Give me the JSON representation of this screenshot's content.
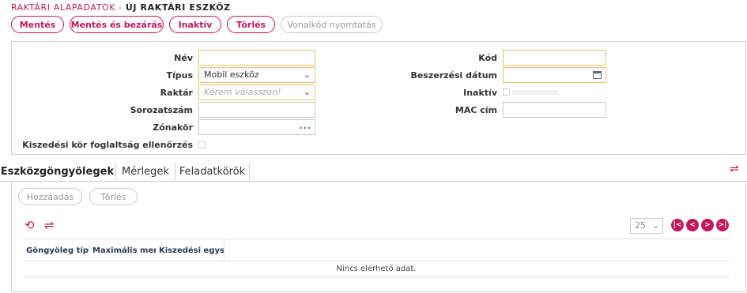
{
  "breadcrumb": {
    "parent": "RAKTÁRI ALAPADATOK -",
    "current": "ÚJ RAKTÁRI ESZKÖZ"
  },
  "toolbar": {
    "save": "Mentés",
    "save_close": "Mentés és bezárás",
    "inactive": "Inaktív",
    "delete": "Törlés",
    "barcode_print": "Vonalkód nyomtatás"
  },
  "form": {
    "nev_label": "Név",
    "nev_value": "",
    "tipus_label": "Típus",
    "tipus_value": "Mobil eszköz",
    "raktar_label": "Raktár",
    "raktar_placeholder": "Kérem válasszon!",
    "sorozatszam_label": "Sorozatszám",
    "sorozatszam_value": "",
    "zonakor_label": "Zónakör",
    "zonakor_dots": "...",
    "kiszedesi_label": "Kiszedési kör foglaltság ellenőrzés",
    "kod_label": "Kód",
    "kod_value": "",
    "beszerzesi_label": "Beszerzési dátum",
    "beszerzesi_value": "",
    "inaktiv_label": "Inaktív",
    "mac_label": "MAC cím",
    "mac_value": ""
  },
  "tabs": [
    "Eszközgöngyölegek",
    "Mérlegek",
    "Feladatkörök"
  ],
  "panel": {
    "add": "Hozzáadás",
    "delete": "Törlés",
    "page_size": "25",
    "columns": [
      "Göngyöleg típus",
      "Maximális menn",
      "Kiszedési egysé"
    ],
    "no_data": "Nincs elérhető adat."
  },
  "colors": {
    "accent": "#c2185b",
    "required_border": "#e9c46a"
  },
  "icons": [
    "chevron-down-icon",
    "calendar-icon",
    "refresh-icon",
    "swap-arrows-icon",
    "first-page-icon",
    "prev-page-icon",
    "next-page-icon",
    "last-page-icon"
  ]
}
